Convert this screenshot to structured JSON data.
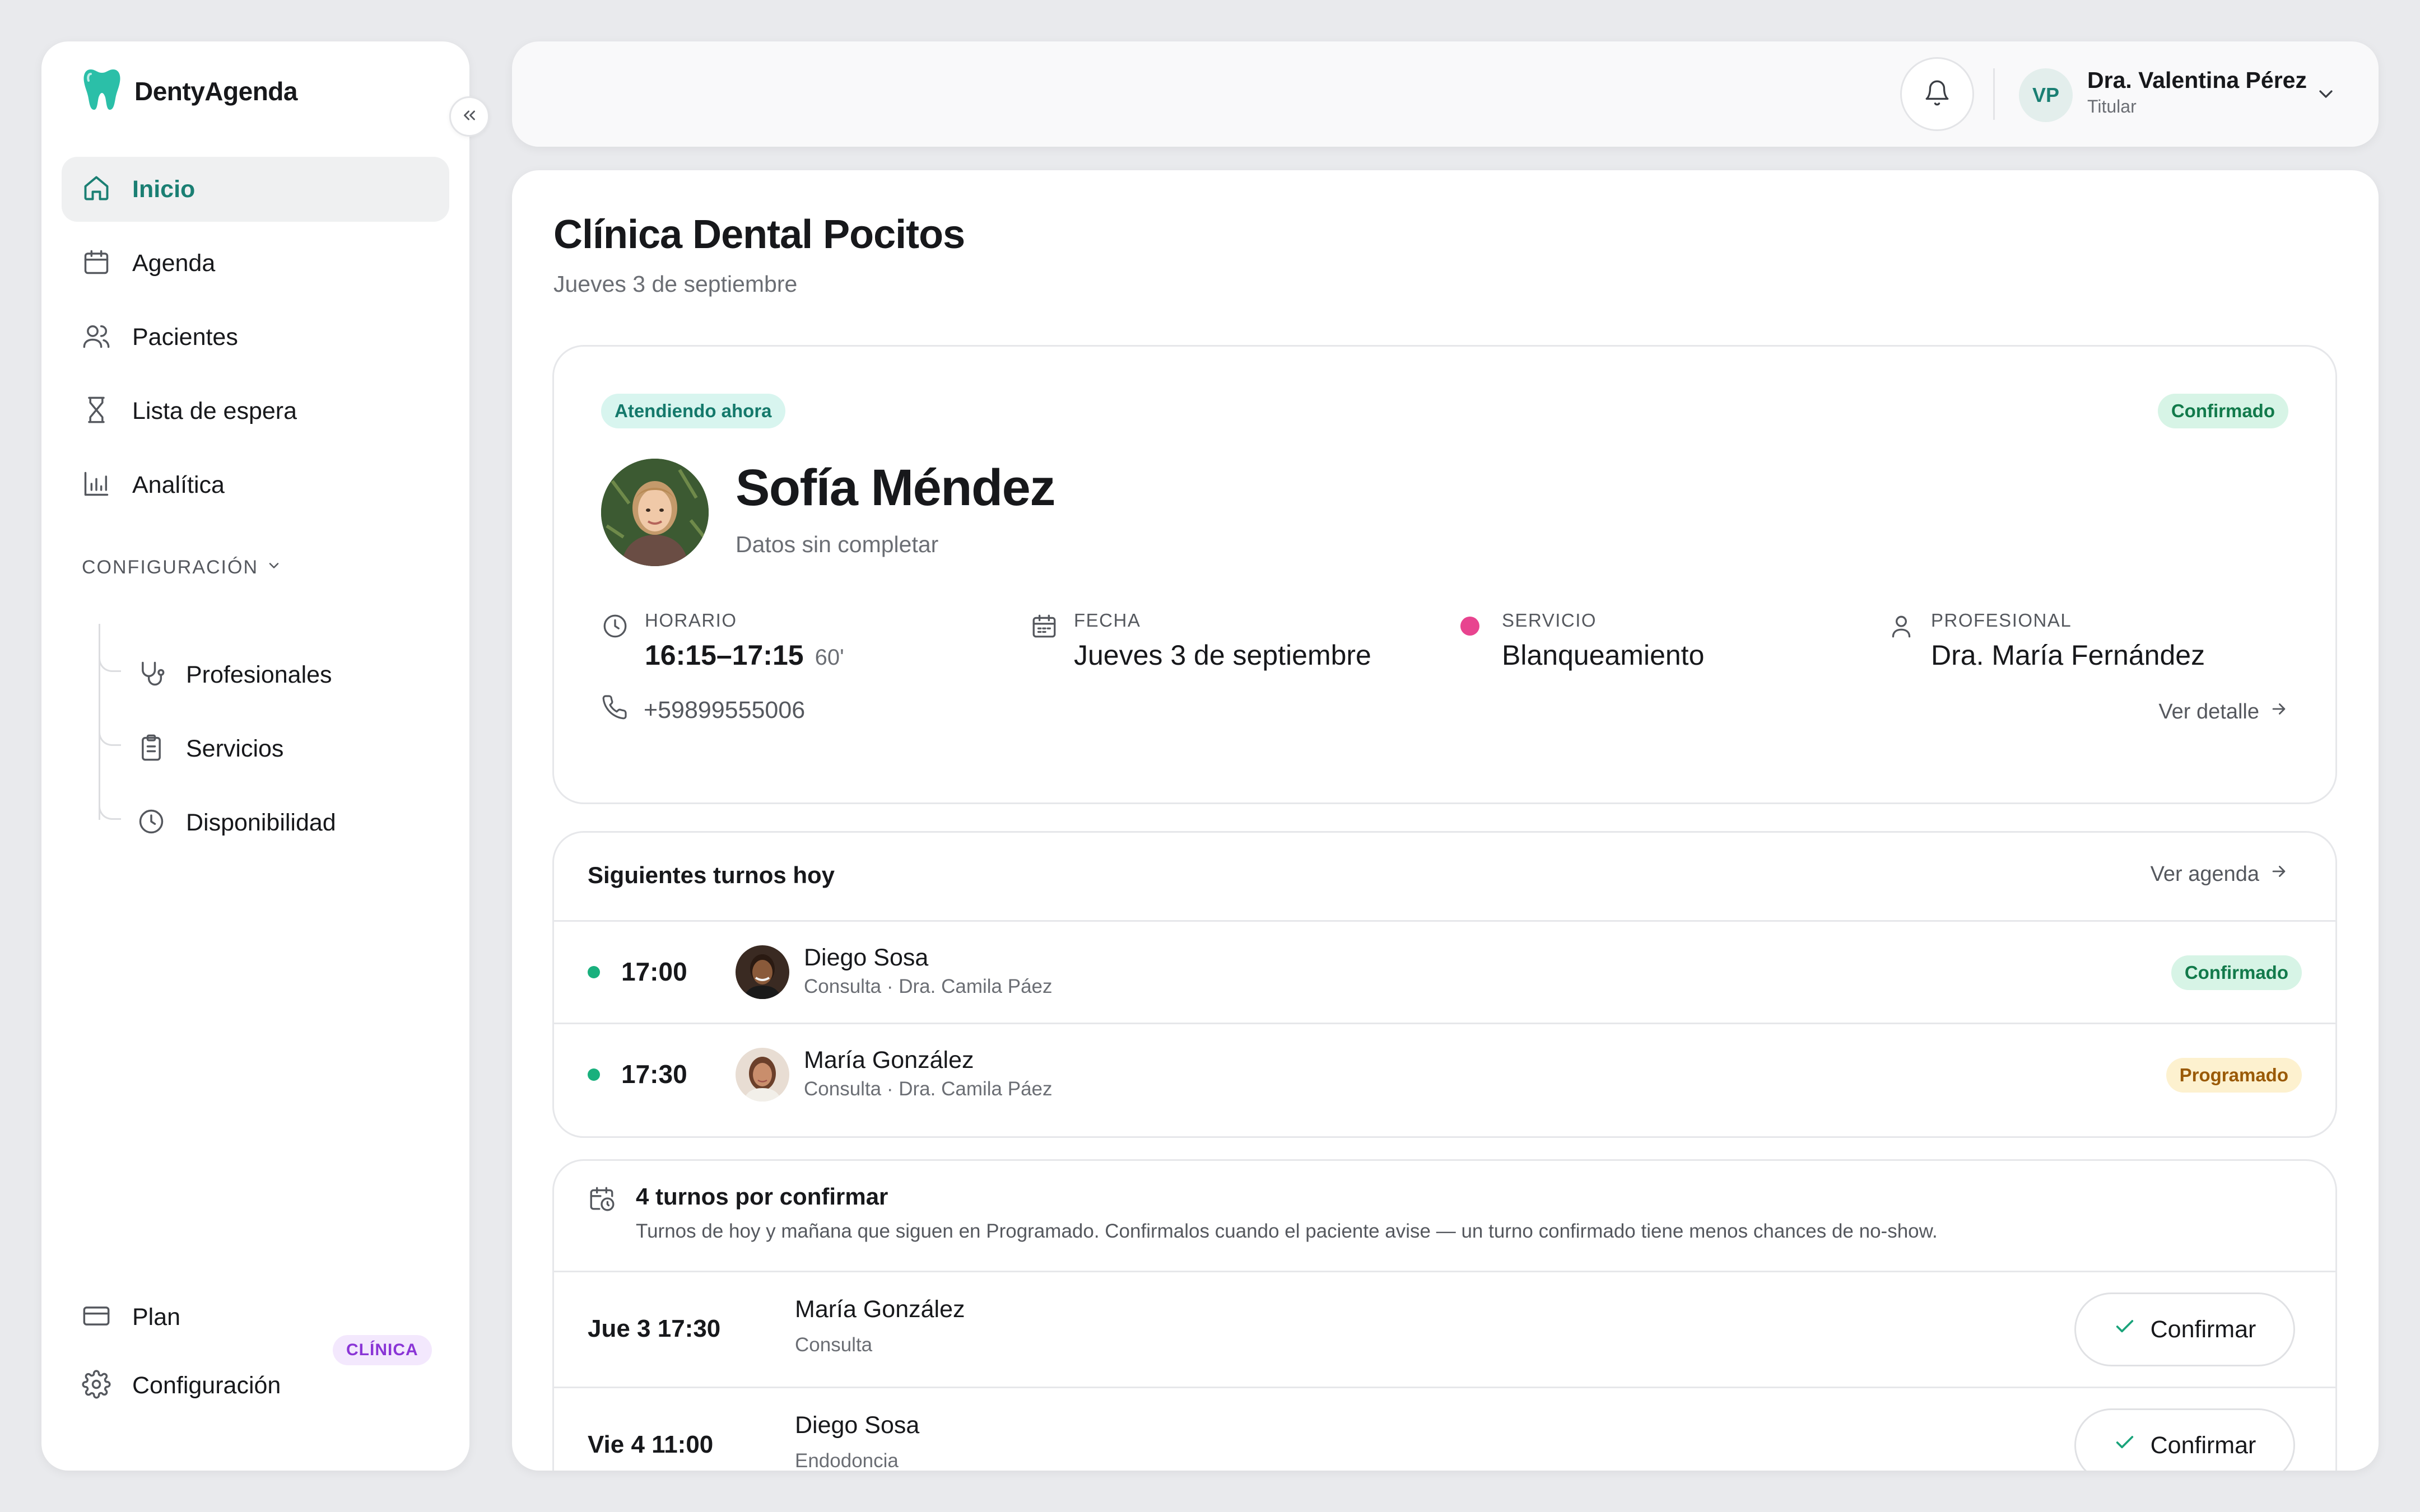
{
  "app": {
    "name": "DentyAgenda",
    "accent": "#1a7f73"
  },
  "sidebar": {
    "items": [
      {
        "label": "Inicio",
        "icon": "home-icon",
        "active": true
      },
      {
        "label": "Agenda",
        "icon": "calendar-icon"
      },
      {
        "label": "Pacientes",
        "icon": "users-icon"
      },
      {
        "label": "Lista de espera",
        "icon": "hourglass-icon"
      },
      {
        "label": "Analítica",
        "icon": "bar-chart-icon"
      }
    ],
    "section_label": "CONFIGURACIÓN",
    "sub_items": [
      {
        "label": "Profesionales",
        "icon": "stethoscope-icon"
      },
      {
        "label": "Servicios",
        "icon": "clipboard-icon"
      },
      {
        "label": "Disponibilidad",
        "icon": "clock-icon"
      }
    ],
    "bottom": [
      {
        "label": "Plan",
        "icon": "credit-card-icon",
        "badge": "CLÍNICA"
      },
      {
        "label": "Configuración",
        "icon": "gear-icon"
      }
    ]
  },
  "header": {
    "user_initials": "VP",
    "user_name": "Dra. Valentina Pérez",
    "user_role": "Titular"
  },
  "main": {
    "title": "Clínica Dental Pocitos",
    "date": "Jueves 3 de septiembre",
    "current": {
      "status_label": "Atendiendo ahora",
      "badge": "Confirmado",
      "patient_name": "Sofía Méndez",
      "patient_sub": "Datos sin completar",
      "schedule_label": "HORARIO",
      "schedule_value": "16:15–17:15",
      "duration": "60'",
      "date_label": "FECHA",
      "date_value": "Jueves 3 de septiembre",
      "service_label": "SERVICIO",
      "service_value": "Blanqueamiento",
      "service_color": "#e8448f",
      "professional_label": "PROFESIONAL",
      "professional_value": "Dra. María Fernández",
      "phone": "+59899555006",
      "detail_link": "Ver detalle"
    },
    "next": {
      "title": "Siguientes turnos hoy",
      "link": "Ver agenda",
      "rows": [
        {
          "time": "17:00",
          "name": "Diego Sosa",
          "meta": "Consulta · Dra. Camila Páez",
          "status": "Confirmado"
        },
        {
          "time": "17:30",
          "name": "María González",
          "meta": "Consulta · Dra. Camila Páez",
          "status": "Programado"
        }
      ]
    },
    "pending": {
      "title": "4 turnos por confirmar",
      "description": "Turnos de hoy y mañana que siguen en Programado. Confirmalos cuando el paciente avise — un turno confirmado tiene menos chances de no-show.",
      "rows": [
        {
          "date": "Jue 3 17:30",
          "name": "María González",
          "service": "Consulta",
          "action": "Confirmar"
        },
        {
          "date": "Vie 4 11:00",
          "name": "Diego Sosa",
          "service": "Endodoncia",
          "action": "Confirmar"
        }
      ]
    }
  }
}
